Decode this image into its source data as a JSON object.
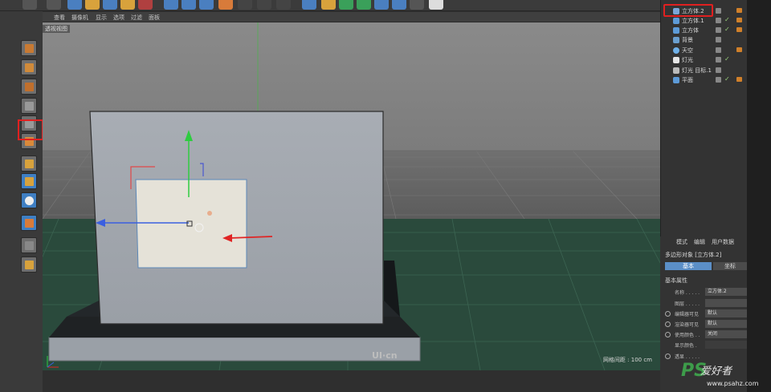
{
  "menubar": {
    "items": [
      "查看",
      "摄像机",
      "显示",
      "选项",
      "过滤",
      "面板"
    ]
  },
  "viewport": {
    "label": "透视视图",
    "grid_info": "网格间距 : 100 cm",
    "watermark": "UI·cn"
  },
  "object_manager": {
    "objects": [
      {
        "name": "立方体.2",
        "icon": "cube-icon"
      },
      {
        "name": "立方体.1",
        "icon": "cube-icon"
      },
      {
        "name": "立方体",
        "icon": "cube-icon"
      },
      {
        "name": "背景",
        "icon": "background-icon"
      },
      {
        "name": "天空",
        "icon": "sky-icon"
      },
      {
        "name": "灯光",
        "icon": "light-icon"
      },
      {
        "name": "灯光 目标.1",
        "icon": "target-light-icon"
      },
      {
        "name": "平面",
        "icon": "plane-icon"
      }
    ]
  },
  "attributes": {
    "tabs": [
      "模式",
      "编辑",
      "用户数据"
    ],
    "object_title": "多边形对象 [立方体.2]",
    "btn_basic": "基本",
    "btn_coord": "坐标",
    "section": "基本属性",
    "rows": [
      {
        "label": "名称 . . . . .",
        "value": "立方体.2"
      },
      {
        "label": "图层 . . . . .",
        "value": ""
      },
      {
        "label": "编辑器可见",
        "value": "默认"
      },
      {
        "label": "渲染器可见",
        "value": "默认"
      },
      {
        "label": "使用颜色 . .",
        "value": "关闭"
      },
      {
        "label": "显示颜色 .",
        "value": ""
      },
      {
        "label": "透显 . . . . .",
        "value": ""
      }
    ]
  },
  "branding": {
    "logo": "PS",
    "logo_text": "爱好者",
    "url": "www.psahz.com"
  },
  "colors": {
    "selection_red": "#e02020",
    "accent_blue": "#5b8fc7",
    "floor_green": "#2a4a3c"
  }
}
